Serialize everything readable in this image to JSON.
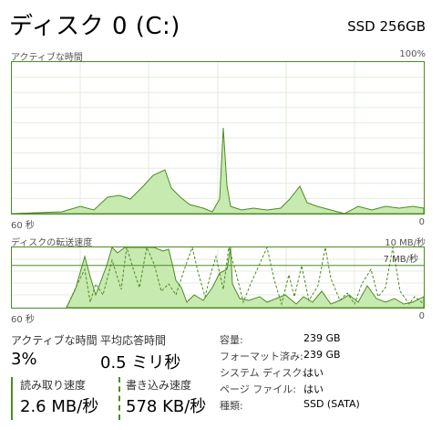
{
  "header": {
    "title": "ディスク 0 (C:)",
    "model": "SSD 256GB"
  },
  "active_time_chart": {
    "label": "アクティブな時間",
    "max_label": "100%",
    "x_left_label": "60 秒",
    "x_right_label": "0",
    "area_color": "#c7eab0",
    "line_color": "#4d8b23"
  },
  "transfer_chart": {
    "label": "ディスクの転送速度",
    "max_label": "10 MB/秒",
    "ref_label": "7 MB/秒",
    "x_left_label": "60 秒",
    "x_right_label": "0"
  },
  "stats": {
    "active_time": {
      "label": "アクティブな時間",
      "value": "3%"
    },
    "response_time": {
      "label": "平均応答時間",
      "value": "0.5 ミリ秒"
    },
    "read_speed": {
      "label": "読み取り速度",
      "value": "2.6 MB/秒"
    },
    "write_speed": {
      "label": "書き込み速度",
      "value": "578 KB/秒"
    }
  },
  "details": [
    {
      "label": "容量:",
      "value": "239 GB"
    },
    {
      "label": "フォーマット済み:",
      "value": "239 GB"
    },
    {
      "label": "システム ディスク:",
      "value": "はい"
    },
    {
      "label": "ページ ファイル:",
      "value": "はい"
    },
    {
      "label": "種類:",
      "value": "SSD (SATA)"
    }
  ]
}
